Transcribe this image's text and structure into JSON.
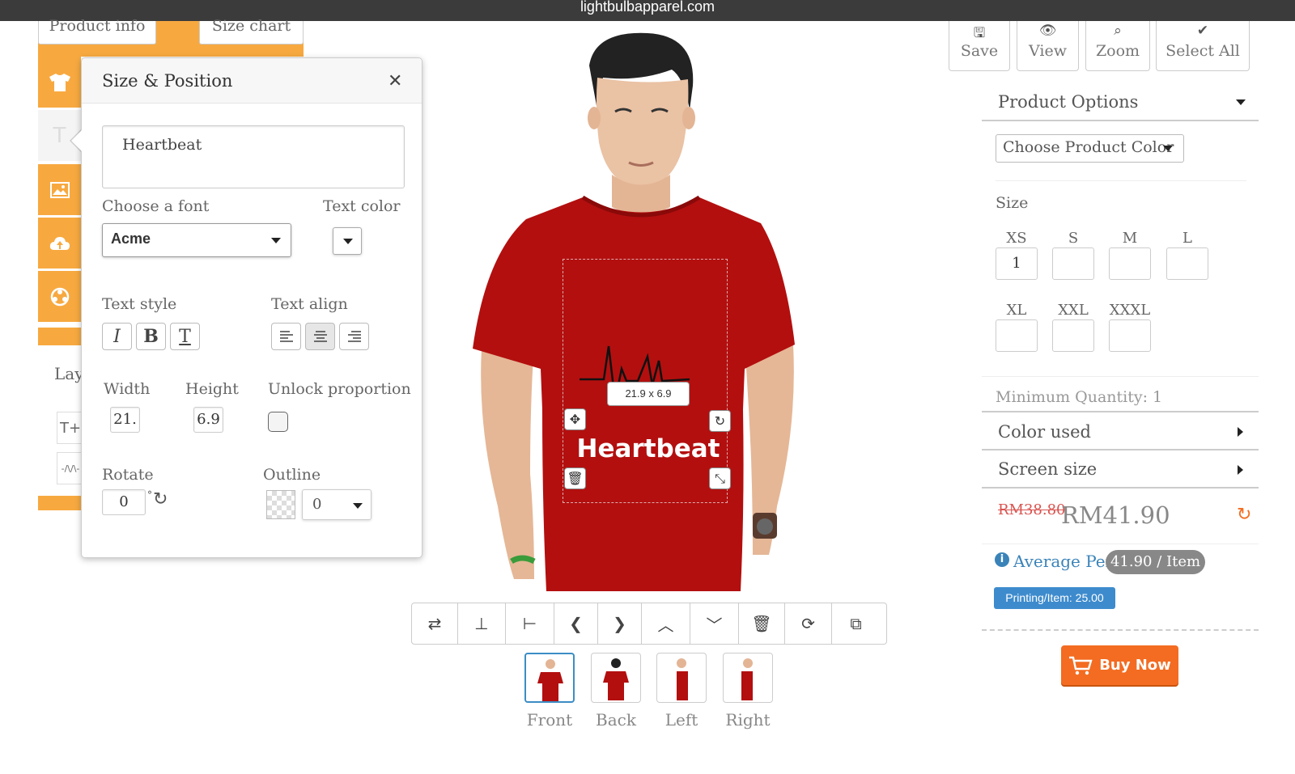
{
  "browser": {
    "url": "lightbulbapparel.com"
  },
  "top_tabs": {
    "product_info": "Product info",
    "size_chart": "Size chart"
  },
  "sidebar": {
    "icons": [
      "tshirt-icon",
      "text-icon",
      "image-icon",
      "upload-icon",
      "clipart-icon"
    ],
    "layers_label": "Lay",
    "layer_items": [
      {
        "label": "T+"
      },
      {
        "label": "-/\\/\\-"
      }
    ]
  },
  "panel": {
    "title": "Size & Position",
    "text_value": "Heartbeat",
    "font_label": "Choose a font",
    "font_value": "Acme",
    "text_color_label": "Text color",
    "text_style_label": "Text style",
    "text_align_label": "Text align",
    "style_buttons": [
      "I",
      "B",
      "T"
    ],
    "width_label": "Width",
    "width_value": "21.",
    "height_label": "Height",
    "height_value": "6.9",
    "unlock_label": "Unlock proportion",
    "rotate_label": "Rotate",
    "rotate_value": "0",
    "degree_symbol": "°",
    "outline_label": "Outline",
    "outline_value": "0"
  },
  "canvas": {
    "size_badge": "21.9 x 6.9",
    "design_text": "Heartbeat",
    "shirt_color": "#b30f0f"
  },
  "views": [
    {
      "label": "Front"
    },
    {
      "label": "Back"
    },
    {
      "label": "Left"
    },
    {
      "label": "Right"
    }
  ],
  "top_right_buttons": {
    "save": "Save",
    "view": "View",
    "zoom": "Zoom",
    "select_all": "Select All"
  },
  "right_panel": {
    "product_options": "Product Options",
    "color_select": "Choose Product Color",
    "size_label": "Size",
    "sizes_row1": [
      {
        "label": "XS",
        "value": "1"
      },
      {
        "label": "S",
        "value": ""
      },
      {
        "label": "M",
        "value": ""
      },
      {
        "label": "L",
        "value": ""
      }
    ],
    "sizes_row2": [
      {
        "label": "XL",
        "value": ""
      },
      {
        "label": "XXL",
        "value": ""
      },
      {
        "label": "XXXL",
        "value": ""
      }
    ],
    "min_qty": "Minimum Quantity: 1",
    "color_used": "Color used",
    "screen_size": "Screen size",
    "price_old": "RM38.80",
    "price_new": "RM41.90",
    "average_label": "Average Per:",
    "average_value": "41.90 / Item",
    "printing": "Printing/Item: 25.00",
    "buy_now": "Buy Now"
  },
  "colors": {
    "accent_orange": "#f7a940",
    "buy_orange": "#f36c21",
    "info_blue": "#3d8bcd"
  }
}
